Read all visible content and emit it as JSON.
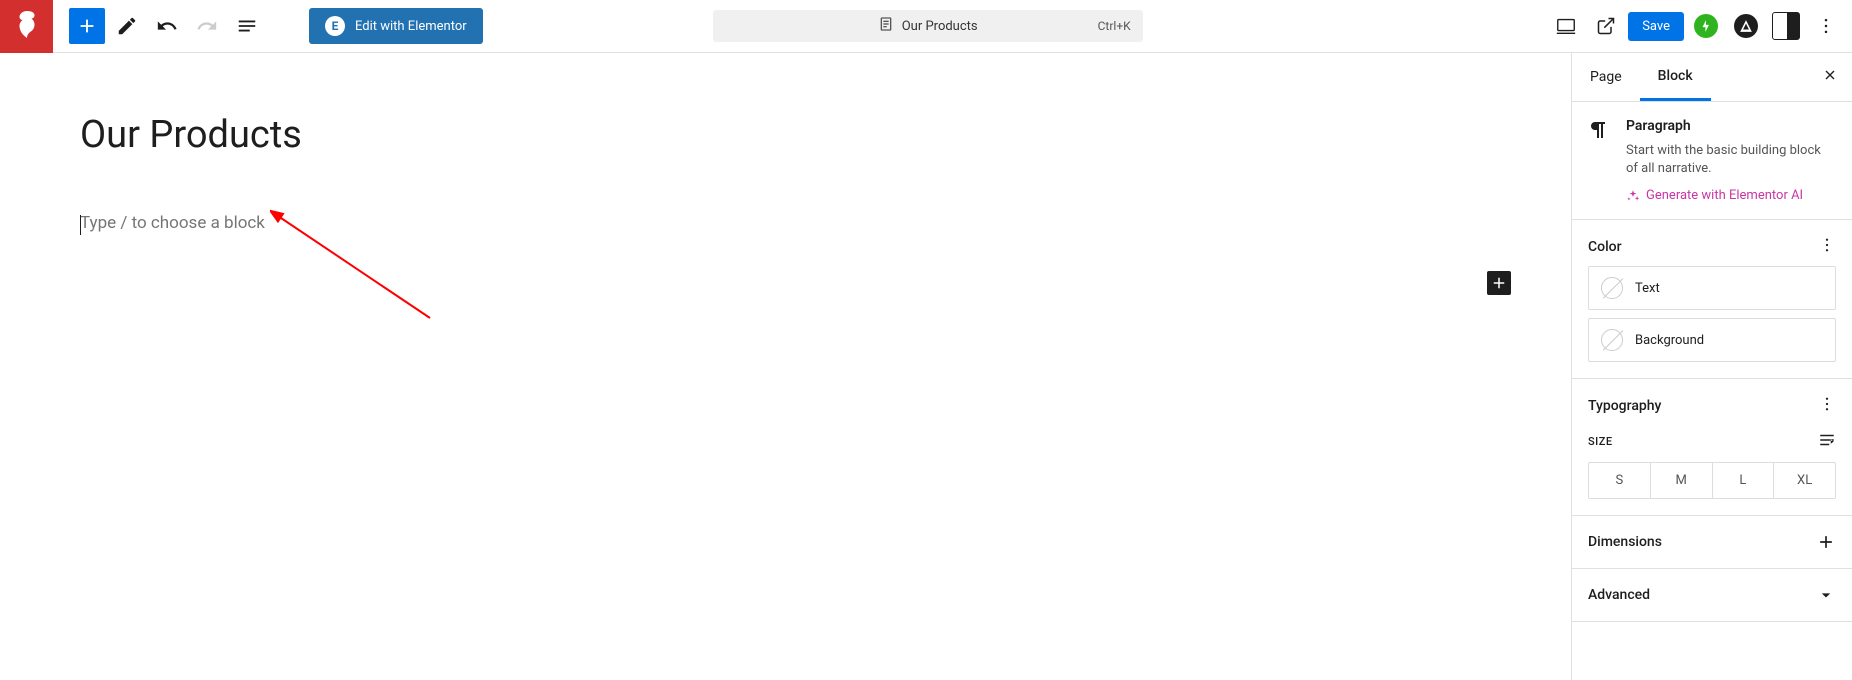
{
  "topbar": {
    "elementor_label": "Edit with Elementor",
    "doc_title": "Our Products",
    "shortcut": "Ctrl+K",
    "save": "Save"
  },
  "editor": {
    "page_title": "Our Products",
    "block_placeholder": "Type / to choose a block"
  },
  "sidebar": {
    "tabs": {
      "page": "Page",
      "block": "Block"
    },
    "block_info": {
      "name": "Paragraph",
      "desc": "Start with the basic building block of all narrative.",
      "ai_label": "Generate with Elementor AI"
    },
    "color": {
      "heading": "Color",
      "text": "Text",
      "background": "Background"
    },
    "typography": {
      "heading": "Typography",
      "size_label": "SIZE",
      "sizes": [
        "S",
        "M",
        "L",
        "XL"
      ]
    },
    "dimensions": "Dimensions",
    "advanced": "Advanced"
  }
}
